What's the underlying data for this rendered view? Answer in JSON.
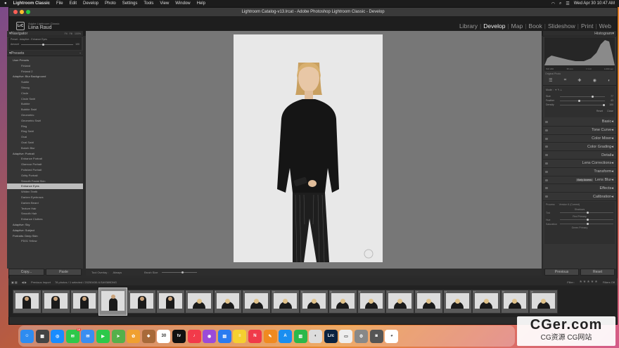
{
  "menubar": {
    "app": "Lightroom Classic",
    "items": [
      "File",
      "Edit",
      "Develop",
      "Photo",
      "Settings",
      "Tools",
      "View",
      "Window",
      "Help"
    ],
    "datetime": "Wed Apr 30  10:47 AM"
  },
  "window": {
    "title": "Lightroom Catalog-v13.lrcat - Adobe Photoshop Lightroom Classic - Develop"
  },
  "identity": {
    "logo": "LrC",
    "small": "Adobe Lightroom Classic",
    "name": "Liina Raud"
  },
  "modules": [
    "Library",
    "Develop",
    "Map",
    "Book",
    "Slideshow",
    "Print",
    "Web"
  ],
  "active_module": "Develop",
  "left": {
    "navigator": {
      "label": "Navigator",
      "opts": [
        "Fit",
        "Fill",
        "100%"
      ],
      "preset": "Preset : Adaptive : Enhance Eyes",
      "amount_label": "Amount",
      "amount_value": "100"
    },
    "presets_label": "Presets",
    "presets": [
      {
        "label": "User Presets",
        "grp": true
      },
      {
        "label": "Finland"
      },
      {
        "label": "Finland 2"
      },
      {
        "label": "Adaptive: Blur Background",
        "grp": true
      },
      {
        "label": "Subtle"
      },
      {
        "label": "Strong"
      },
      {
        "label": "Circle"
      },
      {
        "label": "Circle Swirl"
      },
      {
        "label": "Bubble"
      },
      {
        "label": "Bubble Swirl"
      },
      {
        "label": "Geometric"
      },
      {
        "label": "Geometric Swirl"
      },
      {
        "label": "Ring"
      },
      {
        "label": "Ring Swirl"
      },
      {
        "label": "Oval"
      },
      {
        "label": "Oval Swirl"
      },
      {
        "label": "Bokeh Blur"
      },
      {
        "label": "Adaptive: Portrait",
        "grp": true
      },
      {
        "label": "Enhance Portrait"
      },
      {
        "label": "Glamour Portrait"
      },
      {
        "label": "Polished Portrait"
      },
      {
        "label": "Gritty Portrait"
      },
      {
        "label": "Smooth Facial Skin"
      },
      {
        "label": "Enhance Eyes",
        "sel": true
      },
      {
        "label": "Whiten Teeth"
      },
      {
        "label": "Darken Eyebrows"
      },
      {
        "label": "Darken Beard"
      },
      {
        "label": "Texture Hair"
      },
      {
        "label": "Smooth Hair"
      },
      {
        "label": "Enhance Clothes"
      },
      {
        "label": "Adaptive: Sky",
        "grp": true
      },
      {
        "label": "Adaptive: Subject",
        "grp": true
      },
      {
        "label": "Portraits: Deep Skin",
        "grp": true
      },
      {
        "label": "PD01 Yellow"
      }
    ],
    "copy": "Copy...",
    "paste": "Paste"
  },
  "toolbar": {
    "overlay_label": "Tool Overlay :",
    "overlay_value": "Always",
    "size_label": "Brush Size"
  },
  "right": {
    "histogram_label": "Histogram",
    "histogram_values": [
      "ISO 200",
      "35 mm",
      "f / 4.0",
      "1/160 sec"
    ],
    "original_photo": "Original Photo",
    "mask": {
      "mode_label": "Mode :",
      "rows": [
        {
          "l": "Size",
          "v": "77"
        },
        {
          "l": "Feather",
          "v": "43"
        },
        {
          "l": "Density",
          "v": "100"
        }
      ],
      "reset": "Reset",
      "close": "Close"
    },
    "sections": [
      "Basic",
      "Tone Curve",
      "Color Mixer",
      "Color Grading",
      "Detail",
      "Lens Corrections",
      "Transform",
      "Lens Blur",
      "Effects",
      "Calibration"
    ],
    "early_access": "Early Access",
    "calib": {
      "process_label": "Process",
      "process_value": "Version 6 (Current)",
      "shadows": "Shadows",
      "tint": "Tint",
      "red_primary": "Red Primary",
      "hue": "Hue",
      "saturation": "Saturation",
      "green_primary": "Green Primary"
    },
    "previous": "Previous",
    "reset": "Reset"
  },
  "filmstrip": {
    "source": "Previous Import",
    "count": "78 photos / 1 selected / 20250430-ILSA9389DNG",
    "filter": "Filter :",
    "filters_off": "Filters Off"
  },
  "thumbs": [
    {
      "n": "1"
    },
    {
      "n": "2"
    },
    {
      "n": "3"
    },
    {
      "n": "4",
      "sel": true
    },
    {
      "n": "5"
    },
    {
      "n": "6"
    },
    {
      "n": "7",
      "w": true
    },
    {
      "n": "8",
      "w": true
    },
    {
      "n": "9",
      "w": true
    },
    {
      "n": "10",
      "w": true
    },
    {
      "n": "11",
      "w": true
    },
    {
      "n": "12",
      "w": true
    },
    {
      "n": "13",
      "w": true
    },
    {
      "n": "14",
      "w": true
    },
    {
      "n": "15",
      "w": true
    },
    {
      "n": "16",
      "w": true
    },
    {
      "n": "17",
      "w": true
    },
    {
      "n": "18",
      "w": true
    },
    {
      "n": "19",
      "w": true
    }
  ],
  "dock": [
    {
      "name": "finder",
      "c": "#2e8cf0",
      "t": "☺"
    },
    {
      "name": "launchpad",
      "c": "#444",
      "t": "▦"
    },
    {
      "name": "safari",
      "c": "#1a8cff",
      "t": "◎"
    },
    {
      "name": "messages",
      "c": "#2ec84a",
      "t": "✉",
      "badge": "10"
    },
    {
      "name": "mail",
      "c": "#3a8ef0",
      "t": "✉"
    },
    {
      "name": "facetime",
      "c": "#2cc94a",
      "t": "▶"
    },
    {
      "name": "maps",
      "c": "#55b04a",
      "t": "➤"
    },
    {
      "name": "photos",
      "c": "#f0a030",
      "t": "✿"
    },
    {
      "name": "notes",
      "c": "#a86a3a",
      "t": "❖"
    },
    {
      "name": "calendar",
      "c": "#ffffff",
      "t": "30"
    },
    {
      "name": "tv",
      "c": "#111",
      "t": "tv"
    },
    {
      "name": "music",
      "c": "#f23a4a",
      "t": "♪"
    },
    {
      "name": "podcasts",
      "c": "#9b4bd8",
      "t": "◉"
    },
    {
      "name": "keynote",
      "c": "#2a7bf0",
      "t": "▤"
    },
    {
      "name": "notes2",
      "c": "#f5d030",
      "t": "≡"
    },
    {
      "name": "news",
      "c": "#f03a4a",
      "t": "N"
    },
    {
      "name": "pages",
      "c": "#f08a20",
      "t": "✎"
    },
    {
      "name": "appstore",
      "c": "#1a8ef0",
      "t": "A"
    },
    {
      "name": "numbers",
      "c": "#2ab84a",
      "t": "▥"
    },
    {
      "name": "preview",
      "c": "#ddd",
      "t": "◐"
    },
    {
      "name": "lightroom",
      "c": "#0c2340",
      "t": "Lrc"
    },
    {
      "name": "photoshop",
      "c": "#eee",
      "t": "▭"
    },
    {
      "name": "settings",
      "c": "#888",
      "t": "⚙"
    },
    {
      "name": "camera",
      "c": "#555",
      "t": "◙"
    },
    {
      "name": "chrome",
      "c": "#fff",
      "t": "◕"
    }
  ],
  "watermark": {
    "big": "CGer.com",
    "small": "CG资源 CG网站"
  }
}
